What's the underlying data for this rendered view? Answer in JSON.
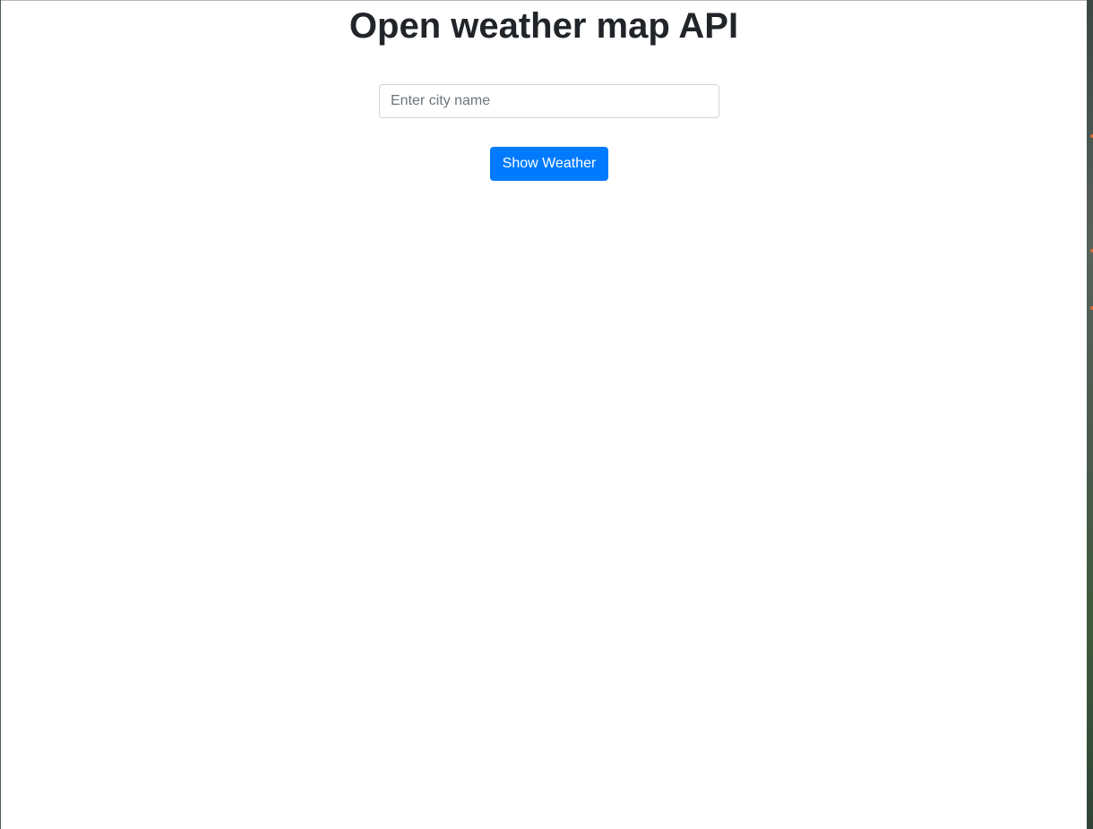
{
  "page": {
    "title": "Open weather map API"
  },
  "search": {
    "value": "",
    "placeholder": "Enter city name"
  },
  "actions": {
    "show_weather_label": "Show Weather"
  },
  "colors": {
    "primary_button": "#007bff",
    "title_text": "#212529",
    "input_border": "#ced4da"
  }
}
